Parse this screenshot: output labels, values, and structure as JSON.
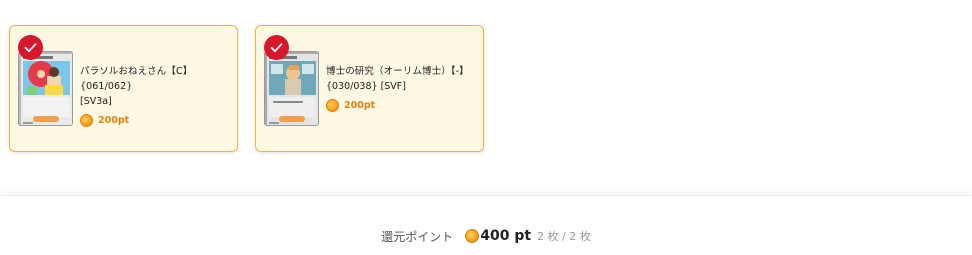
{
  "cards": [
    {
      "name": "パラソルおねえさん【C】{061/062}",
      "code": "[SV3a]",
      "points": "200pt",
      "selected": true
    },
    {
      "name": "博士の研究（オーリム博士）【-】",
      "code": "{030/038} [SVF]",
      "points": "200pt",
      "selected": true
    }
  ],
  "footer": {
    "label": "還元ポイント",
    "points": "400 pt",
    "count": "2 枚 / 2 枚"
  },
  "icons": {
    "check": "check-icon",
    "coin": "coin-icon"
  },
  "colors": {
    "card_bg": "#fef8e5",
    "card_border": "#f2b33a",
    "check_red": "#d7172b",
    "point_orange": "#e8820c"
  }
}
